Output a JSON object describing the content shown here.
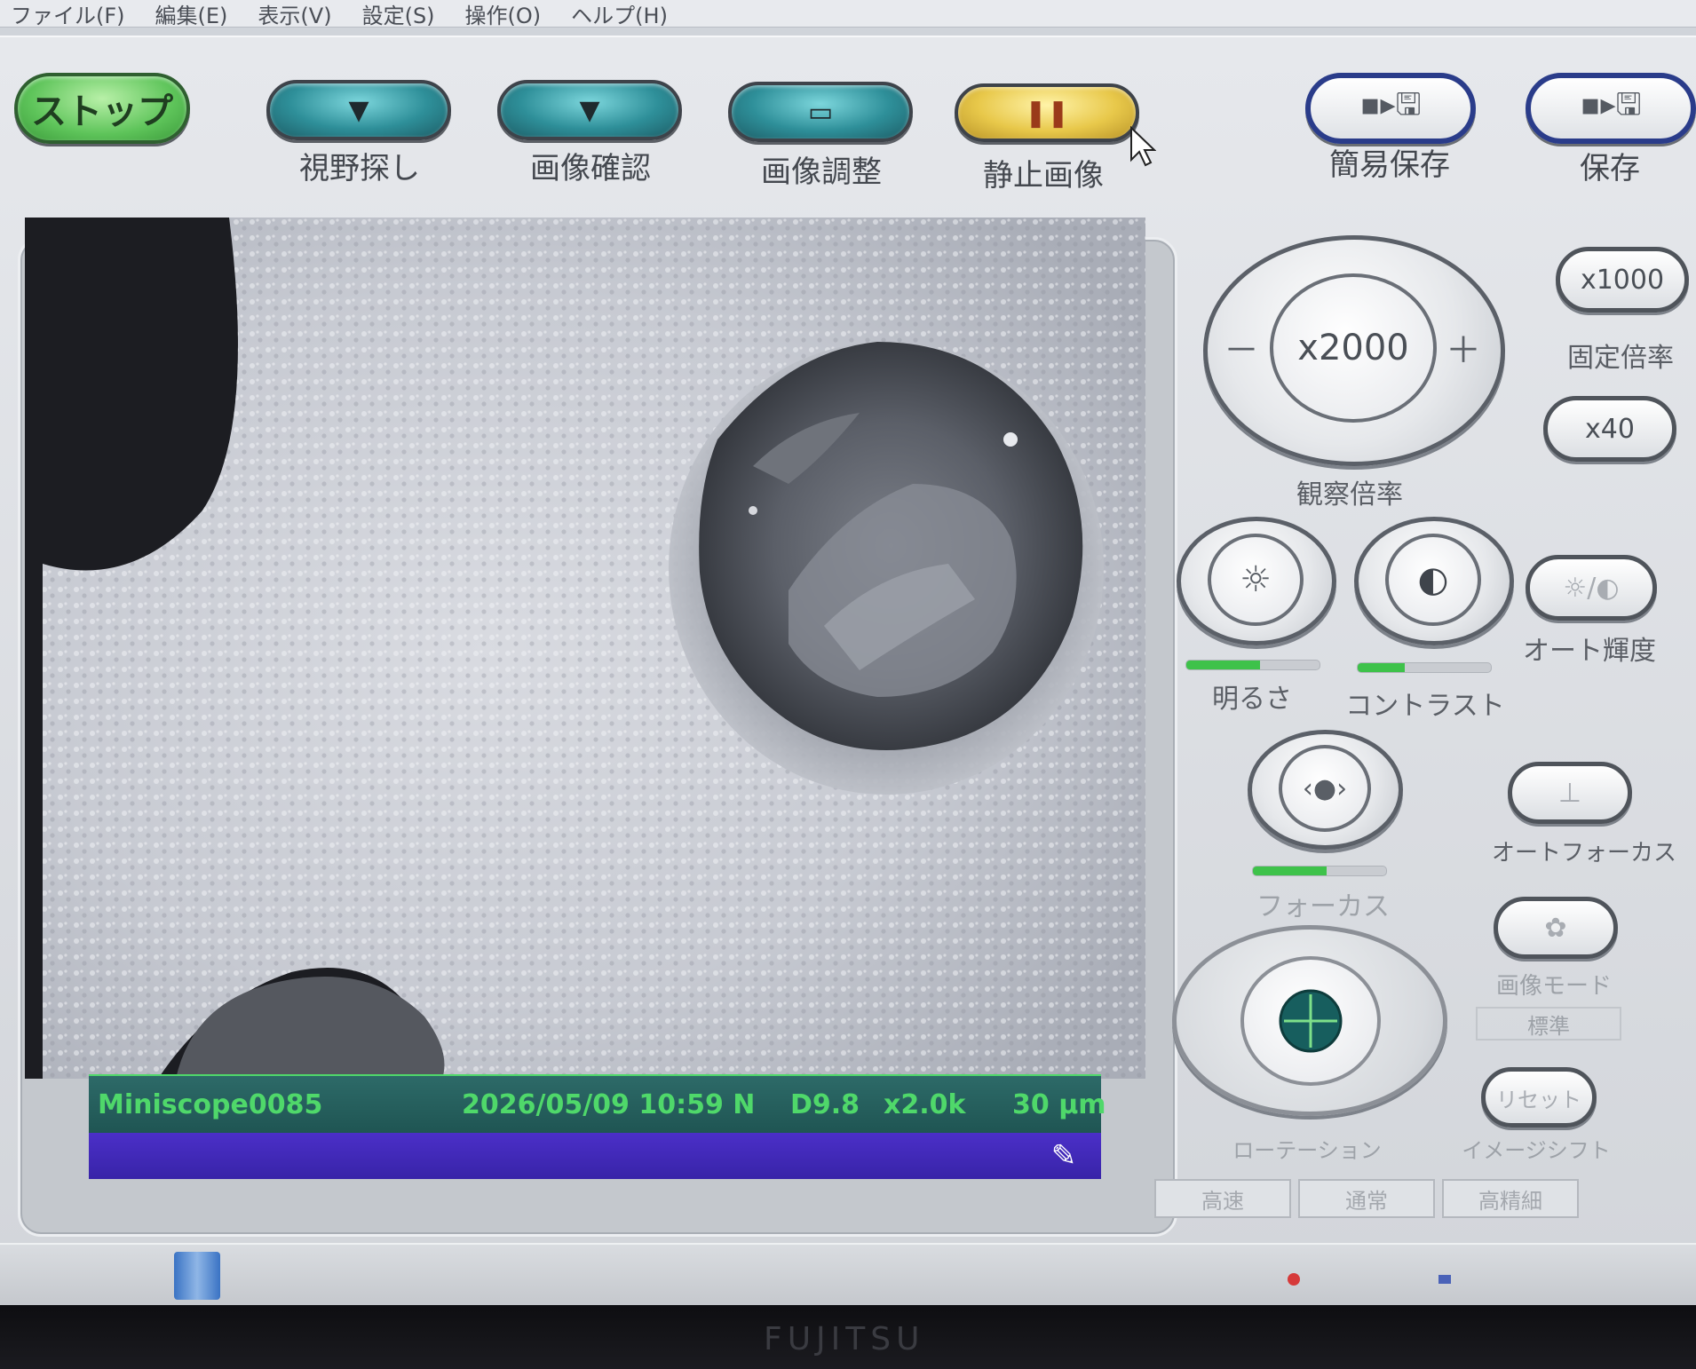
{
  "menu": [
    "ファイル(F)",
    "編集(E)",
    "表示(V)",
    "設定(S)",
    "操作(O)",
    "ヘルプ(H)"
  ],
  "toolbar": {
    "stop": "ストップ",
    "buttons": [
      {
        "label": "視野探し",
        "glyph": "▼"
      },
      {
        "label": "画像確認",
        "glyph": "▼"
      },
      {
        "label": "画像調整",
        "glyph": "▭"
      },
      {
        "label": "静止画像",
        "glyph": "❚❚"
      }
    ],
    "quick_save": "簡易保存",
    "save": "保存",
    "save_glyph": "▪▸🖫"
  },
  "viewer": {
    "instrument": "Miniscope0085",
    "datetime": "2026/05/09 10:59 N",
    "distance": "D9.8",
    "magnification": "x2.0k",
    "scale": "30 μm"
  },
  "controls": {
    "magnification_value": "x2000",
    "magnification_label": "観察倍率",
    "minus": "－",
    "plus": "＋",
    "preset_high": "x1000",
    "preset_low": "x40",
    "fixed_mag_label": "固定倍率",
    "brightness_label": "明るさ",
    "brightness_level": 0.55,
    "contrast_label": "コントラスト",
    "contrast_level": 0.35,
    "auto_brightness_label": "オート輝度",
    "focus_label": "フォーカス",
    "focus_level": 0.55,
    "autofocus_label": "オートフォーカス",
    "image_mode_label": "画像モード",
    "image_mode_value": "標準",
    "reset_label": "リセット",
    "rotation_label": "ローテーション",
    "image_shift_label": "イメージシフト",
    "tabs": [
      "高速",
      "通常",
      "高精細"
    ]
  }
}
